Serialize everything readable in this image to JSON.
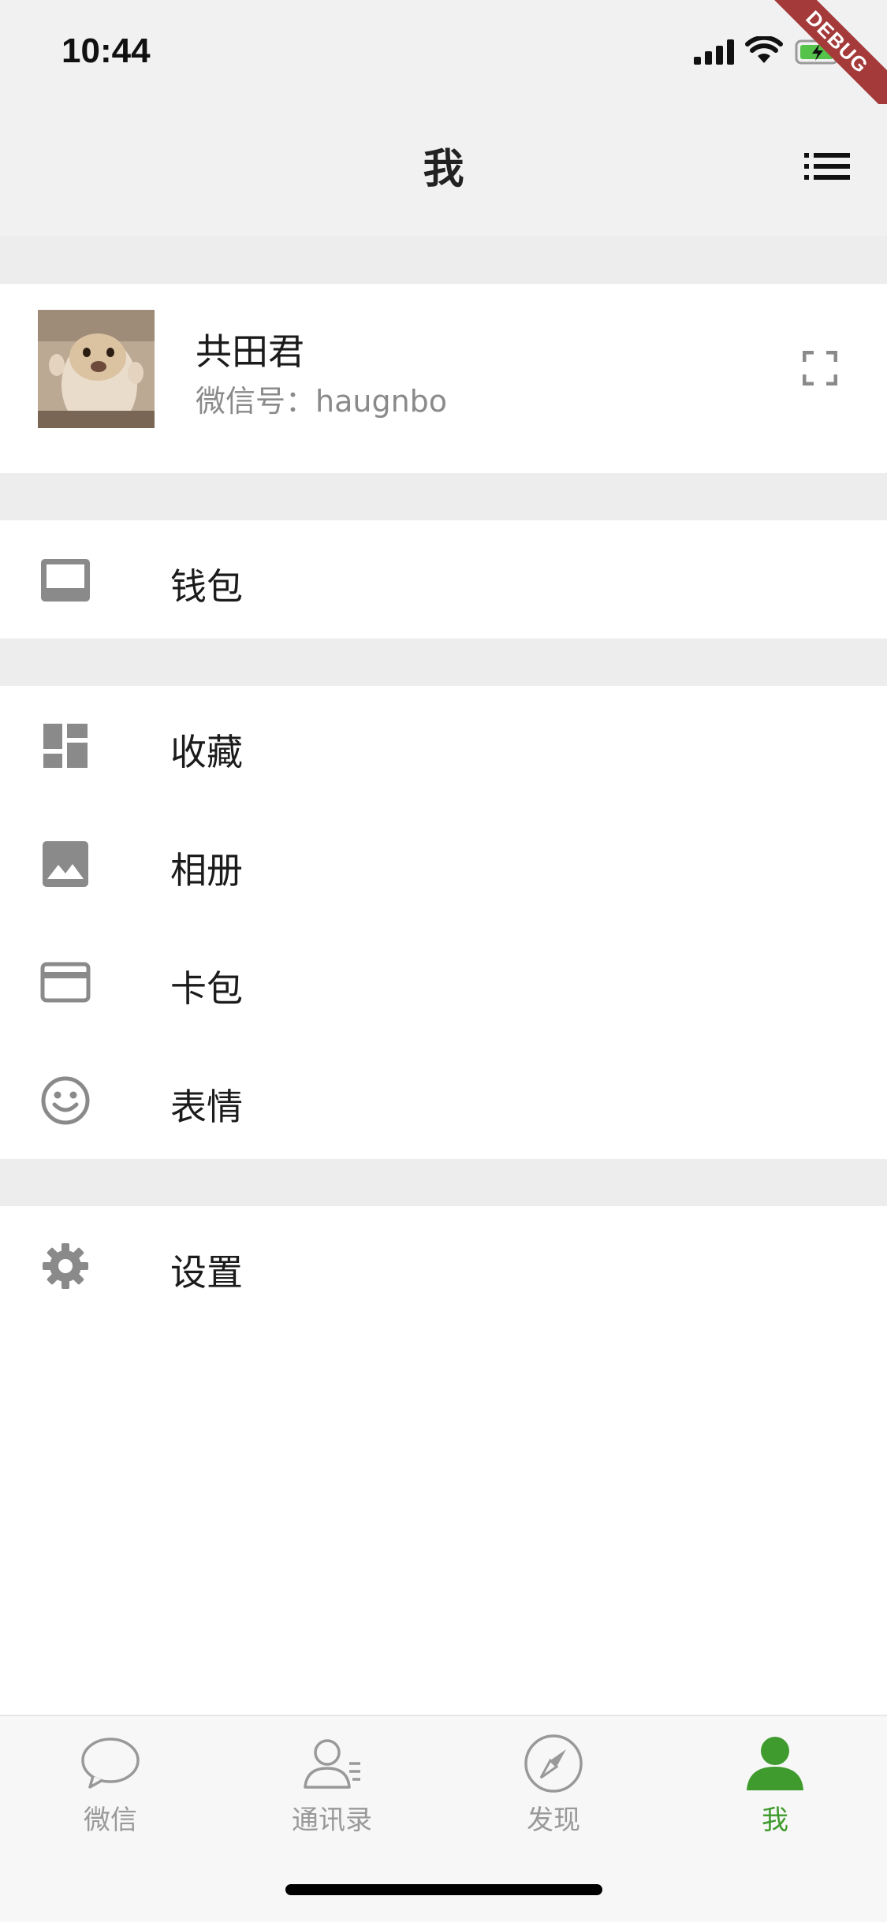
{
  "status_bar": {
    "time": "10:44",
    "debug_ribbon": "DEBUG"
  },
  "nav": {
    "title": "我",
    "menu_icon": "list-icon"
  },
  "profile": {
    "name": "共田君",
    "wechat_id": "微信号：haugnbo",
    "avatar_icon": "avatar-hamster",
    "qr_icon": "qr-scan-icon"
  },
  "menu": {
    "wallet": {
      "label": "钱包",
      "icon": "wallet-icon"
    },
    "favorites": {
      "label": "收藏",
      "icon": "dashboard-icon"
    },
    "album": {
      "label": "相册",
      "icon": "image-icon"
    },
    "cards": {
      "label": "卡包",
      "icon": "credit-card-icon"
    },
    "stickers": {
      "label": "表情",
      "icon": "smiley-icon"
    },
    "settings": {
      "label": "设置",
      "icon": "gear-icon"
    }
  },
  "tabs": [
    {
      "label": "微信",
      "icon": "chat-bubble-icon",
      "active": false
    },
    {
      "label": "通讯录",
      "icon": "contacts-icon",
      "active": false
    },
    {
      "label": "发现",
      "icon": "compass-icon",
      "active": false
    },
    {
      "label": "我",
      "icon": "person-icon",
      "active": true
    }
  ],
  "colors": {
    "accent": "#3f9b2d",
    "inactive_tab": "#999999",
    "icon_gray": "#8a8a8a",
    "section_gap": "#ededed",
    "header_bg": "#f1f1f1",
    "debug_ribbon": "#a53a3a"
  }
}
